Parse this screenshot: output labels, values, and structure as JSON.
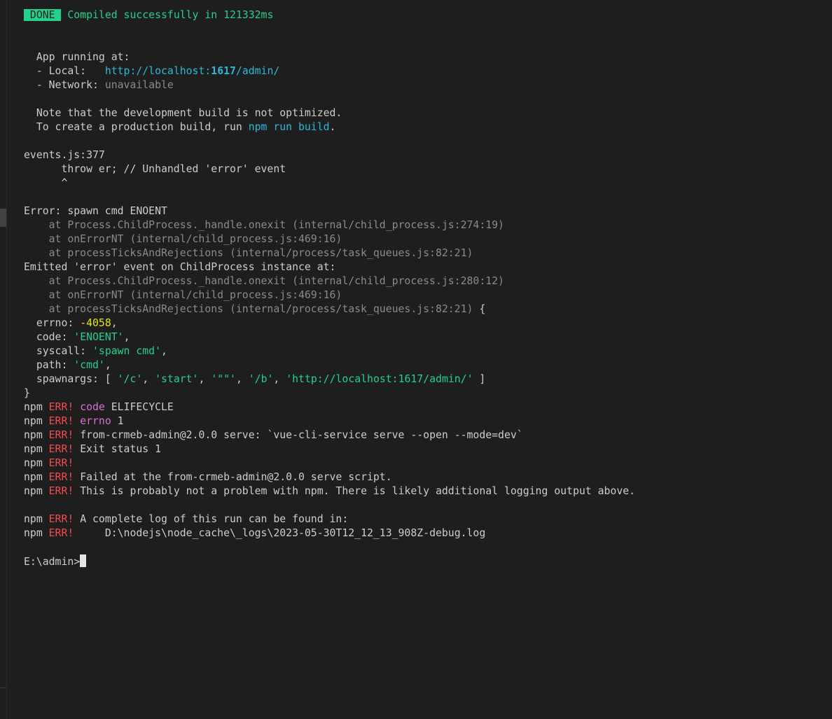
{
  "terminal": {
    "done_badge": " DONE ",
    "compiled": "Compiled successfully in 121332ms",
    "app_running": "App running at:",
    "local_label": "- Local:   ",
    "local_url_prefix": "http://localhost:",
    "local_port": "1617",
    "local_url_suffix": "/admin/",
    "network_label": "- Network: ",
    "network_value": "unavailable",
    "note_line": "Note that the development build is not optimized.",
    "prod_prefix": "To create a production build, run ",
    "prod_cmd": "npm run build",
    "prod_suffix": ".",
    "events_line": "events.js:377",
    "throw_line": "      throw er; // Unhandled 'error' event",
    "caret_line": "      ^",
    "error_line": "Error: spawn cmd ENOENT",
    "stack1": [
      "    at Process.ChildProcess._handle.onexit (internal/child_process.js:274:19)",
      "    at onErrorNT (internal/child_process.js:469:16)",
      "    at processTicksAndRejections (internal/process/task_queues.js:82:21)"
    ],
    "emitted_line": "Emitted 'error' event on ChildProcess instance at:",
    "stack2": [
      "    at Process.ChildProcess._handle.onexit (internal/child_process.js:280:12)",
      "    at onErrorNT (internal/child_process.js:469:16)",
      "    at processTicksAndRejections (internal/process/task_queues.js:82:21)"
    ],
    "brace_open": " {",
    "errno_key": "  errno: ",
    "errno_val": "-4058",
    "code_key": "  code: ",
    "code_val": "'ENOENT'",
    "syscall_key": "  syscall: ",
    "syscall_val": "'spawn cmd'",
    "path_key": "  path: ",
    "path_val": "'cmd'",
    "spawnargs_key": "  spawnargs: [ ",
    "spawnargs_vals": [
      "'/c'",
      "'start'",
      "'\"\"'",
      "'/b'",
      "'http://localhost:1617/admin/'"
    ],
    "spawnargs_sep": ", ",
    "spawnargs_end": " ]",
    "brace_close": "}",
    "npm": "npm ",
    "err": "ERR!",
    "err_lines": [
      {
        "key": "code",
        "rest": " ELIFECYCLE"
      },
      {
        "key": "errno",
        "rest": " 1"
      }
    ],
    "err_plain": [
      " from-crmeb-admin@2.0.0 serve: `vue-cli-service serve --open --mode=dev`",
      " Exit status 1",
      "",
      " Failed at the from-crmeb-admin@2.0.0 serve script.",
      " This is probably not a problem with npm. There is likely additional logging output above."
    ],
    "err_log": [
      " A complete log of this run can be found in:",
      "     D:\\nodejs\\node_cache\\_logs\\2023-05-30T12_12_13_908Z-debug.log"
    ],
    "prompt": "E:\\admin>"
  },
  "colors": {
    "background": "#1e1e1e",
    "done_badge": "#23d18b",
    "link": "#29b8db",
    "error_red": "#f14c4c",
    "yellow": "#e5e510",
    "magenta": "#d670d6"
  }
}
